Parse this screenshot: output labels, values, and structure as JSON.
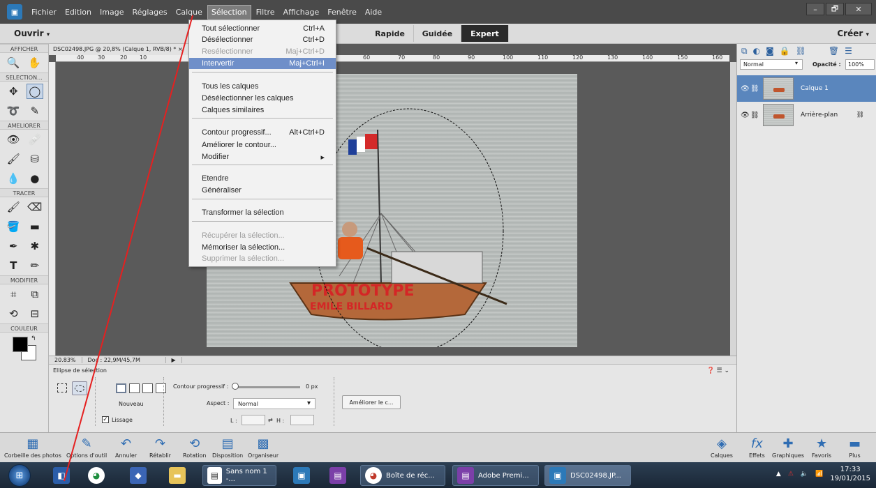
{
  "menubar": {
    "items": [
      "Fichier",
      "Edition",
      "Image",
      "Réglages",
      "Calque",
      "Sélection",
      "Filtre",
      "Affichage",
      "Fenêtre",
      "Aide"
    ],
    "active_index": 5,
    "window_buttons": [
      "–",
      "🗗",
      "✕"
    ]
  },
  "modebar": {
    "open_label": "Ouvrir",
    "modes": [
      "Rapide",
      "Guidée",
      "Expert"
    ],
    "active_mode": "Expert",
    "create_label": "Créer"
  },
  "toolbox": {
    "sections": [
      "AFFICHER",
      "SELECTION...",
      "AMELIORER",
      "TRACER",
      "MODIFIER",
      "COULEUR"
    ]
  },
  "document": {
    "tab_title": "DSC02498.JPG @ 20,8% (Calque 1, RVB/8) *",
    "ruler_ticks": [
      "40",
      "30",
      "20",
      "10",
      "40",
      "50",
      "60",
      "70",
      "80",
      "90",
      "100",
      "110",
      "120",
      "130",
      "140",
      "150",
      "160"
    ],
    "flag_colors": [
      "#1f3f99",
      "#ffffff",
      "#d42a2a"
    ],
    "boat_text_1": "PROTOTYPE",
    "boat_text_2": "EMILE BILLARD"
  },
  "status": {
    "zoom": "20.83%",
    "doc_size": "Doc : 22,9M/45,7M"
  },
  "options": {
    "tool_name": "Ellipse de sélection",
    "mode_label": "Nouveau",
    "feather_label": "Contour progressif :",
    "feather_value": "0 px",
    "aspect_label": "Aspect :",
    "aspect_value": "Normal",
    "width_label": "L :",
    "height_label": "H :",
    "smoothing_label": "Lissage",
    "improve_button": "Améliorer le c..."
  },
  "layers": {
    "blend_mode": "Normal",
    "opacity_label": "Opacité :",
    "opacity_value": "100%",
    "items": [
      {
        "name": "Calque 1",
        "selected": true
      },
      {
        "name": "Arrière-plan",
        "selected": false
      }
    ]
  },
  "panelbar": {
    "left": [
      "Corbeille des photos",
      "Options d'outil",
      "Annuler",
      "Rétablir",
      "Rotation",
      "Disposition",
      "Organiseur"
    ],
    "right": [
      "Calques",
      "Effets",
      "Graphiques",
      "Favoris",
      "Plus"
    ]
  },
  "taskbar": {
    "apps": [
      {
        "label": "Sans nom 1 -..."
      },
      {
        "label": "Boîte de réc..."
      },
      {
        "label": "Adobe Premi..."
      },
      {
        "label": "DSC02498.JP..."
      }
    ],
    "time": "17:33",
    "date": "19/01/2015"
  },
  "selection_menu": {
    "items": [
      {
        "label": "Tout sélectionner",
        "shortcut": "Ctrl+A",
        "state": "normal"
      },
      {
        "label": "Désélectionner",
        "shortcut": "Ctrl+D",
        "state": "normal"
      },
      {
        "label": "Resélectionner",
        "shortcut": "Maj+Ctrl+D",
        "state": "disabled"
      },
      {
        "label": "Intervertir",
        "shortcut": "Maj+Ctrl+I",
        "state": "highlighted"
      },
      {
        "label": "Tous les calques",
        "shortcut": "",
        "state": "normal"
      },
      {
        "label": "Désélectionner les calques",
        "shortcut": "",
        "state": "normal"
      },
      {
        "label": "Calques similaires",
        "shortcut": "",
        "state": "normal"
      },
      {
        "label": "Contour progressif...",
        "shortcut": "Alt+Ctrl+D",
        "state": "normal"
      },
      {
        "label": "Améliorer le contour...",
        "shortcut": "",
        "state": "normal"
      },
      {
        "label": "Modifier",
        "shortcut": "▸",
        "state": "normal"
      },
      {
        "label": "Etendre",
        "shortcut": "",
        "state": "normal"
      },
      {
        "label": "Généraliser",
        "shortcut": "",
        "state": "normal"
      },
      {
        "label": "Transformer la sélection",
        "shortcut": "",
        "state": "normal"
      },
      {
        "label": "Récupérer la sélection...",
        "shortcut": "",
        "state": "disabled"
      },
      {
        "label": "Mémoriser la sélection...",
        "shortcut": "",
        "state": "normal"
      },
      {
        "label": "Supprimer la sélection...",
        "shortcut": "",
        "state": "disabled"
      }
    ]
  }
}
